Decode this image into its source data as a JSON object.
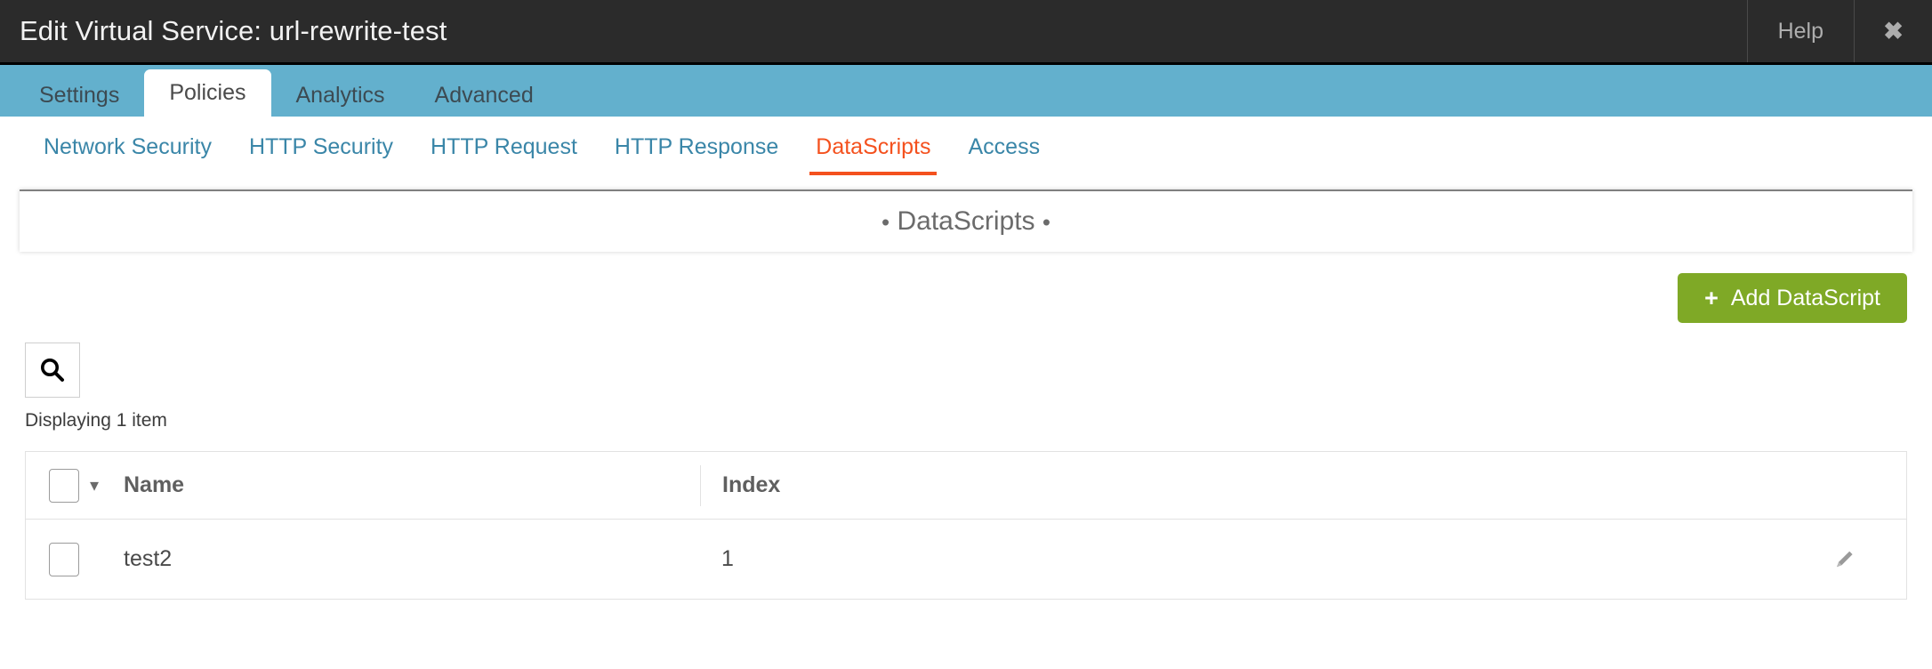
{
  "titlebar": {
    "title": "Edit Virtual Service: url-rewrite-test",
    "help_label": "Help",
    "close_label": "✖"
  },
  "tabs": [
    {
      "label": "Settings",
      "active": false
    },
    {
      "label": "Policies",
      "active": true
    },
    {
      "label": "Analytics",
      "active": false
    },
    {
      "label": "Advanced",
      "active": false
    }
  ],
  "subnav": [
    {
      "label": "Network Security",
      "active": false
    },
    {
      "label": "HTTP Security",
      "active": false
    },
    {
      "label": "HTTP Request",
      "active": false
    },
    {
      "label": "HTTP Response",
      "active": false
    },
    {
      "label": "DataScripts",
      "active": true
    },
    {
      "label": "Access",
      "active": false
    }
  ],
  "panel": {
    "title": "DataScripts",
    "bullet": "•"
  },
  "actions": {
    "add_label": "Add DataScript",
    "add_icon": "plus-icon",
    "add_color": "#7fa926"
  },
  "tools": {
    "search_icon": "search-icon",
    "count_text": "Displaying 1 item"
  },
  "table": {
    "columns": [
      "Name",
      "Index"
    ],
    "rows": [
      {
        "name": "test2",
        "index": "1"
      }
    ],
    "row_action_icon": "pencil-icon"
  },
  "colors": {
    "header_bg": "#2b2b2b",
    "tabbar_bg": "#63b0cd",
    "link": "#3a86a8",
    "accent": "#f4511e",
    "green": "#7fa926"
  }
}
